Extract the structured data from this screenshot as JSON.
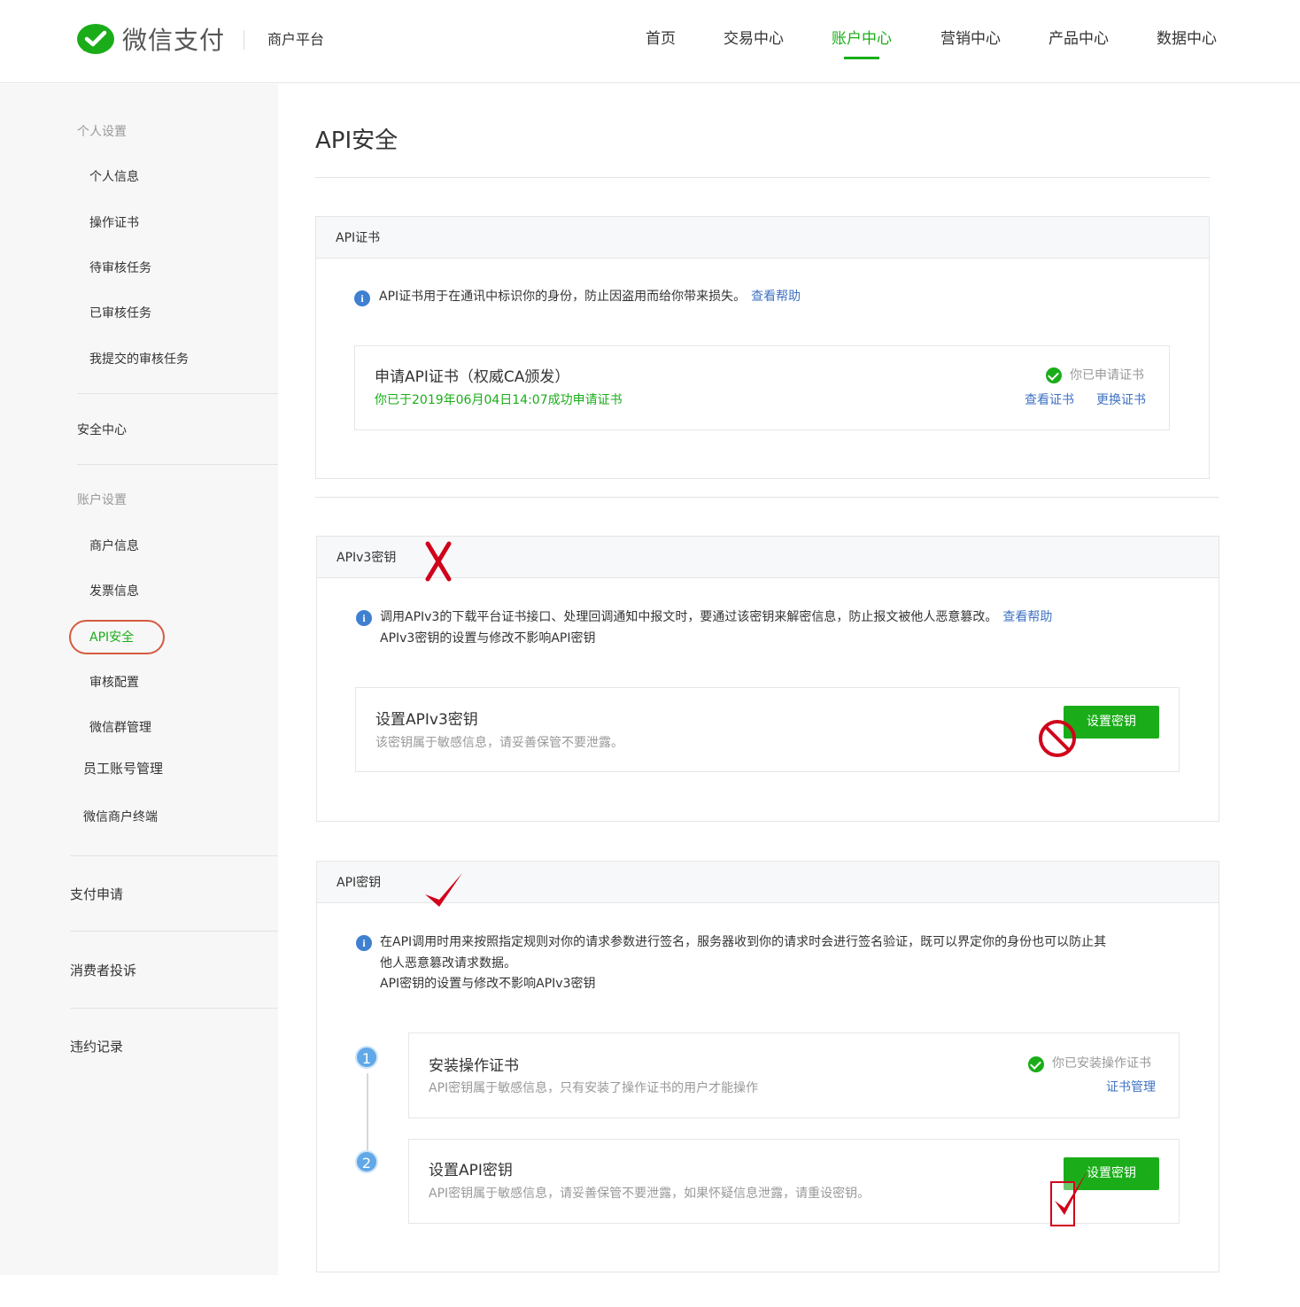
{
  "header": {
    "brand": "微信支付",
    "platform": "商户平台",
    "nav": [
      "首页",
      "交易中心",
      "账户中心",
      "营销中心",
      "产品中心",
      "数据中心"
    ],
    "active_nav": "账户中心"
  },
  "sidebar": {
    "personal_group": "个人设置",
    "personal_items": [
      "个人信息",
      "操作证书",
      "待审核任务",
      "已审核任务",
      "我提交的审核任务"
    ],
    "security_center": "安全中心",
    "account_group": "账户设置",
    "account_items": [
      "商户信息",
      "发票信息",
      "API安全",
      "审核配置",
      "微信群管理"
    ],
    "employee_accounts": "员工账号管理",
    "merchant_terminal": "微信商户终端",
    "pay_apply": "支付申请",
    "complaints": "消费者投诉",
    "violations": "违约记录"
  },
  "page": {
    "title": "API安全",
    "cert_panel": {
      "header": "API证书",
      "info": "API证书用于在通讯中标识你的身份，防止因盗用而给你带来损失。",
      "help_link": "查看帮助",
      "card_title": "申请API证书（权威CA颁发）",
      "card_status_text": "你已于2019年06月04日14:07成功申请证书",
      "applied_label": "你已申请证书",
      "view_link": "查看证书",
      "replace_link": "更换证书"
    },
    "v3_panel": {
      "header": "APIv3密钥",
      "info_line1": "调用APIv3的下载平台证书接口、处理回调通知中报文时，要通过该密钥来解密信息，防止报文被他人恶意篡改。",
      "help_link": "查看帮助",
      "info_line2": "APIv3密钥的设置与修改不影响API密钥",
      "card_title": "设置APIv3密钥",
      "card_sub": "该密钥属于敏感信息，请妥善保管不要泄露。",
      "button": "设置密钥"
    },
    "key_panel": {
      "header": "API密钥",
      "info_line1": "在API调用时用来按照指定规则对你的请求参数进行签名，服务器收到你的请求时会进行签名验证，既可以界定你的身份也可以防止其",
      "info_line2": "他人恶意篡改请求数据。",
      "info_line3": "API密钥的设置与修改不影响APIv3密钥",
      "step1_num": "1",
      "step1_title": "安装操作证书",
      "step1_sub": "API密钥属于敏感信息，只有安装了操作证书的用户才能操作",
      "step1_status": "你已安装操作证书",
      "step1_link": "证书管理",
      "step2_num": "2",
      "step2_title": "设置API密钥",
      "step2_sub": "API密钥属于敏感信息，请妥善保管不要泄露，如果怀疑信息泄露，请重设密钥。",
      "button": "设置密钥"
    }
  },
  "annotations": {
    "x_mark": "X",
    "accent": "#1aad19",
    "red": "#d0021b"
  }
}
